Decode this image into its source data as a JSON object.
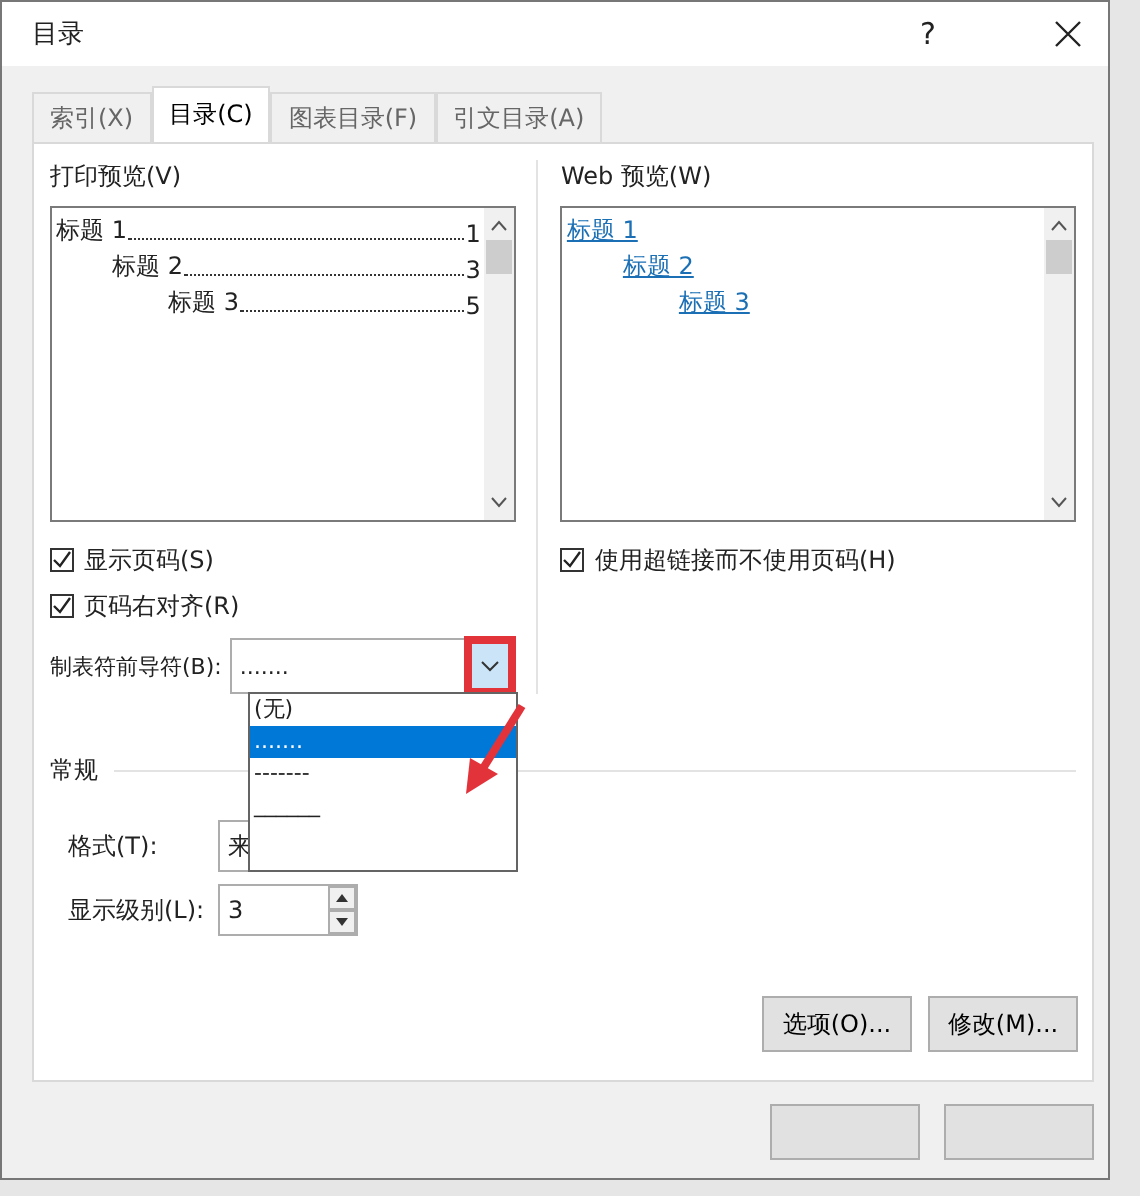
{
  "window": {
    "title": "目录",
    "help": "?"
  },
  "tabs": [
    {
      "label": "索引(X)",
      "selected": false
    },
    {
      "label": "目录(C)",
      "selected": true
    },
    {
      "label": "图表目录(F)",
      "selected": false
    },
    {
      "label": "引文目录(A)",
      "selected": false
    }
  ],
  "print_preview": {
    "label": "打印预览(V)",
    "entries": [
      {
        "text": "标题 1",
        "page": "1",
        "children": [
          {
            "text": "标题 2",
            "page": "3",
            "children": [
              {
                "text": "标题 3",
                "page": "5"
              }
            ]
          }
        ]
      }
    ]
  },
  "web_preview": {
    "label": "Web 预览(W)",
    "entries": [
      {
        "text": "标题 1",
        "children": [
          {
            "text": "标题 2",
            "children": [
              {
                "text": "标题 3"
              }
            ]
          }
        ]
      }
    ]
  },
  "left_checkboxes": [
    {
      "label": "显示页码(S)",
      "checked": true
    },
    {
      "label": "页码右对齐(R)",
      "checked": true
    }
  ],
  "right_checkboxes": [
    {
      "label": "使用超链接而不使用页码(H)",
      "checked": true
    }
  ],
  "leader": {
    "label": "制表符前导符(B):",
    "value": ".......",
    "open": true,
    "options": [
      {
        "text": "(无)",
        "selected": false
      },
      {
        "text": ".......",
        "selected": true
      },
      {
        "text": "-------",
        "selected": false
      },
      {
        "text": "______",
        "selected": false
      }
    ]
  },
  "general": {
    "heading": "常规",
    "format": {
      "label": "格式(T):",
      "value": "来"
    },
    "levels": {
      "label": "显示级别(L):",
      "value": "3"
    }
  },
  "buttons": [
    "选项(O)...",
    "修改(M)..."
  ]
}
